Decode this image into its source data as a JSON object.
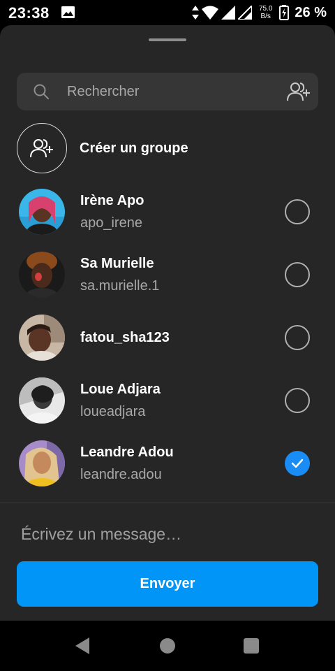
{
  "status_bar": {
    "time": "23:38",
    "net_speed_value": "75.0",
    "net_speed_unit": "B/s",
    "battery": "26 %",
    "icons": [
      "gallery-icon",
      "data-arrows-icon",
      "wifi-icon",
      "signal-icon",
      "signal-icon",
      "battery-charging-icon"
    ]
  },
  "search": {
    "placeholder": "Rechercher",
    "icon": "search-icon",
    "add_icon": "add-people-icon"
  },
  "create_group": {
    "label": "Créer un groupe",
    "icon": "group-add-icon"
  },
  "contacts": [
    {
      "name": "Irène Apo",
      "username": "apo_irene",
      "selected": false
    },
    {
      "name": "Sa Murielle",
      "username": "sa.murielle.1",
      "selected": false
    },
    {
      "name": "fatou_sha123",
      "username": "",
      "selected": false
    },
    {
      "name": "Loue Adjara",
      "username": "loueadjara",
      "selected": false
    },
    {
      "name": "Leandre Adou",
      "username": "leandre.adou",
      "selected": true
    }
  ],
  "composer": {
    "placeholder": "Écrivez un message…",
    "send_label": "Envoyer"
  },
  "colors": {
    "accent": "#0095f6",
    "sheet_bg": "#262626",
    "search_bg": "#363636",
    "check_blue": "#1a8cf5"
  },
  "nav_bar": {
    "icons": [
      "back-icon",
      "home-icon",
      "recents-icon"
    ]
  }
}
